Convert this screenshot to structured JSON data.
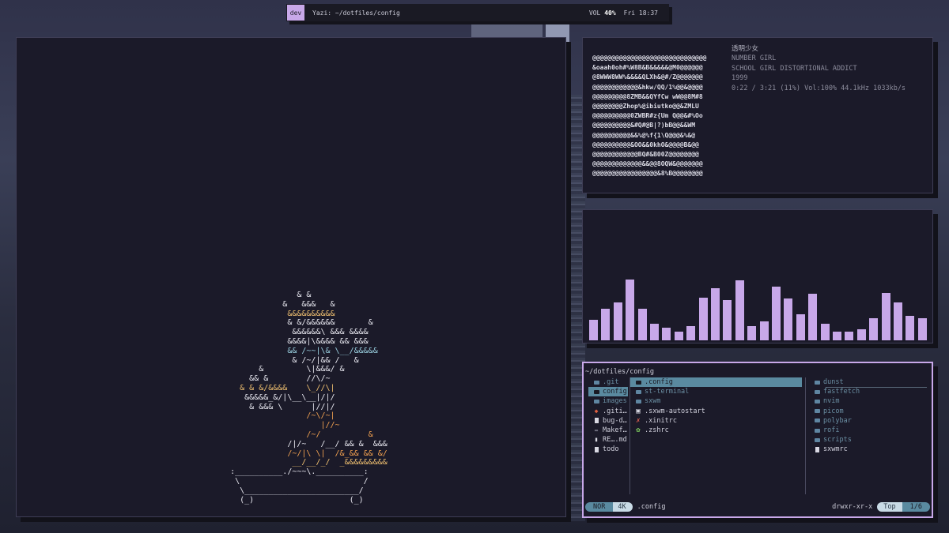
{
  "topbar": {
    "workspace": "dev",
    "title": "Yazi: ~/dotfiles/config",
    "vol_label": "VOL",
    "vol_value": "40%",
    "clock": "Fri 18:37"
  },
  "bonsai": {
    "lines": [
      {
        "t": "                  & &",
        "c": "#e8e8f0"
      },
      {
        "t": "               &   &&&   &",
        "c": "#e8e8f0"
      },
      {
        "t": "                &&&&&&&&&&",
        "c": "#f0c070"
      },
      {
        "t": "                & &/&&&&&&       &",
        "c": "#e8e8f0"
      },
      {
        "t": "                 &&&&&&\\ &&& &&&&",
        "c": "#e8e8f0"
      },
      {
        "t": "                &&&&|\\&&&& && &&&",
        "c": "#e8e8f0"
      },
      {
        "t": "                && /~~|\\& \\__/&&&&&",
        "c": "#9ad0e0"
      },
      {
        "t": "                 & /~/|&& /   &",
        "c": "#e8e8f0"
      },
      {
        "t": "          &         \\|&&&/ &",
        "c": "#e8e8f0"
      },
      {
        "t": "        && &        //\\/~",
        "c": "#e8e8f0"
      },
      {
        "t": "      & & &/&&&&    \\_//\\|",
        "c": "#f0c070"
      },
      {
        "t": "       &&&&&_&/|\\__\\__|/|/",
        "c": "#e8e8f0"
      },
      {
        "t": "        & &&& \\      |//|/",
        "c": "#e8e8f0"
      },
      {
        "t": "                    /~\\/~|",
        "c": "#f0a050"
      },
      {
        "t": "                       |//~",
        "c": "#f0a050"
      },
      {
        "t": "                    /~/          &",
        "c": "#f0a050"
      },
      {
        "t": "                /|/~   /__/ && &  &&&",
        "c": "#e8e8f0"
      },
      {
        "t": "                /~/|\\ \\|  /&_&& && &/",
        "c": "#f0a050"
      },
      {
        "t": "                 __/__/_/  _&&&&&&&&&",
        "c": "#f0c070"
      },
      {
        "t": "    :__________./~~~\\.__________:",
        "c": "#e8e8f0"
      },
      {
        "t": "     \\                          /",
        "c": "#e8e8f0"
      },
      {
        "t": "      \\________________________/",
        "c": "#e8e8f0"
      },
      {
        "t": "      (_)                    (_)",
        "c": "#e8e8f0"
      }
    ]
  },
  "now_playing": {
    "art": "@@@@@@@@@@@@@@@@@@@@@@@@@@@@@@\n&oaah0oh#%W8B&B&&&&&@M0@@@@@@\n@8WWW8WW%&&&&QLXh&@#/Z@@@@@@@\n@@@@@@@@@@@@&hkw/QQ/1%@@&@@@@\n@@@@@@@@@8ZMB&&QYfCw wW@@8M#8\n@@@@@@@@Zhop%@ibiutko@@&ZMLU\n@@@@@@@@@@0ZWBR#z{Um Q@@&#%Oo\n@@@@@@@@@@&#Q#@B|?)bB@@&&WM\n@@@@@@@@@@&&%@%f{1\\Q@@@&%&@\n@@@@@@@@@@&OO&&0khO&@@@@B&@@\n@@@@@@@@@@@@BQ#&B00Z@@@@@@@@\n@@@@@@@@@@@@@&&@@8OQW&@@@@@@@\n@@@@@@@@@@@@@@@@@&8%B@@@@@@@@",
    "song": "透明少女",
    "artist": "NUMBER GIRL",
    "album": "SCHOOL GIRL DISTORTIONAL ADDICT",
    "year": "1999",
    "progress": "0:22 / 3:21 (11%) Vol:100% 44.1kHz 1033kb/s"
  },
  "visualizer": {
    "color": "#c8a8e9",
    "levels": [
      0.3,
      0.46,
      0.55,
      0.88,
      0.45,
      0.24,
      0.18,
      0.13,
      0.2,
      0.61,
      0.75,
      0.58,
      0.86,
      0.2,
      0.27,
      0.77,
      0.6,
      0.37,
      0.67,
      0.24,
      0.13,
      0.13,
      0.16,
      0.32,
      0.68,
      0.54,
      0.35,
      0.32
    ]
  },
  "yazi": {
    "path": "~/dotfiles/config",
    "parent": [
      {
        "name": ".git",
        "kind": "dir-git"
      },
      {
        "name": "config",
        "kind": "dir",
        "selected": true
      },
      {
        "name": "images",
        "kind": "dir"
      },
      {
        "name": ".giti…",
        "kind": "git"
      },
      {
        "name": "bug-d…",
        "kind": "file"
      },
      {
        "name": "Makef…",
        "kind": "make"
      },
      {
        "name": "RE….md",
        "kind": "md"
      },
      {
        "name": "todo",
        "kind": "file"
      }
    ],
    "current": [
      {
        "name": ".config",
        "kind": "dir-cfg",
        "selected": true
      },
      {
        "name": "st-terminal",
        "kind": "dir"
      },
      {
        "name": "sxwm",
        "kind": "dir"
      },
      {
        "name": ".sxwm-autostart",
        "kind": "term"
      },
      {
        "name": ".xinitrc",
        "kind": "x"
      },
      {
        "name": ".zshrc",
        "kind": "gear"
      }
    ],
    "preview": [
      {
        "name": "dunst",
        "kind": "dir"
      },
      {
        "name": "fastfetch",
        "kind": "dir"
      },
      {
        "name": "nvim",
        "kind": "dir"
      },
      {
        "name": "picom",
        "kind": "dir"
      },
      {
        "name": "polybar",
        "kind": "dir"
      },
      {
        "name": "rofi",
        "kind": "dir"
      },
      {
        "name": "scripts",
        "kind": "dir"
      },
      {
        "name": "sxwmrc",
        "kind": "file"
      }
    ],
    "status": {
      "mode": "NOR",
      "size": "4K",
      "file": ".config",
      "perm": "drwxr-xr-x",
      "position": "Top",
      "count": "1/6"
    }
  }
}
